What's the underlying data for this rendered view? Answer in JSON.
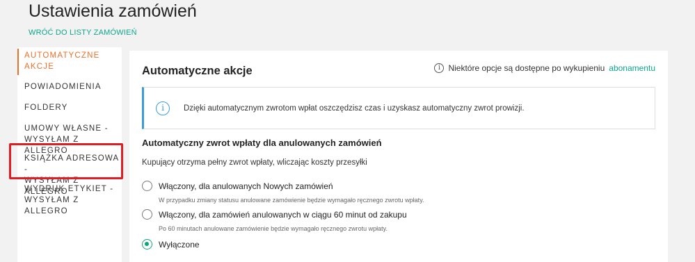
{
  "header": {
    "title": "Ustawienia zamówień",
    "back_link": "WRÓĆ DO LISTY ZAMÓWIEŃ"
  },
  "sidebar": {
    "items": [
      {
        "line1": "AUTOMATYCZNE",
        "line2": "AKCJE",
        "active": true
      },
      {
        "line1": "POWIADOMIENIA",
        "line2": ""
      },
      {
        "line1": "FOLDERY",
        "line2": ""
      },
      {
        "line1": "UMOWY WŁASNE -",
        "line2": "WYSYŁAM Z ALLEGRO"
      },
      {
        "line1": "KSIĄŻKA ADRESOWA -",
        "line2": "WYSYŁAM Z ALLEGRO"
      },
      {
        "line1": "WYDRUK ETYKIET -",
        "line2": "WYSYŁAM Z ALLEGRO"
      }
    ]
  },
  "panel": {
    "title": "Automatyczne akcje",
    "note": "Niektóre opcje są dostępne po wykupieniu",
    "note_link": "abonamentu",
    "info": "Dzięki automatycznym zwrotom wpłat oszczędzisz czas i uzyskasz automatyczny zwrot prowizji.",
    "section_title": "Automatyczny zwrot wpłaty dla anulowanych zamówień",
    "section_desc": "Kupujący otrzyma pełny zwrot wpłaty, wliczając koszty przesyłki",
    "options": [
      {
        "label": "Włączony, dla anulowanych Nowych zamówień",
        "hint": "W przypadku zmiany statusu anulowane zamówienie będzie wymagało ręcznego zwrotu wpłaty.",
        "checked": false
      },
      {
        "label": "Włączony, dla zamówień anulowanych w ciągu 60 minut od zakupu",
        "hint": "Po 60 minutach anulowane zamówienie będzie wymagało ręcznego zwrotu wpłaty.",
        "checked": false
      },
      {
        "label": "Wyłączone",
        "hint": "",
        "checked": true
      }
    ]
  },
  "colors": {
    "accent_orange": "#e8702a",
    "link_green": "#0ea58c",
    "info_blue": "#3a9bd9",
    "highlight_red": "#e31b23",
    "radio_green": "#10a37f"
  }
}
